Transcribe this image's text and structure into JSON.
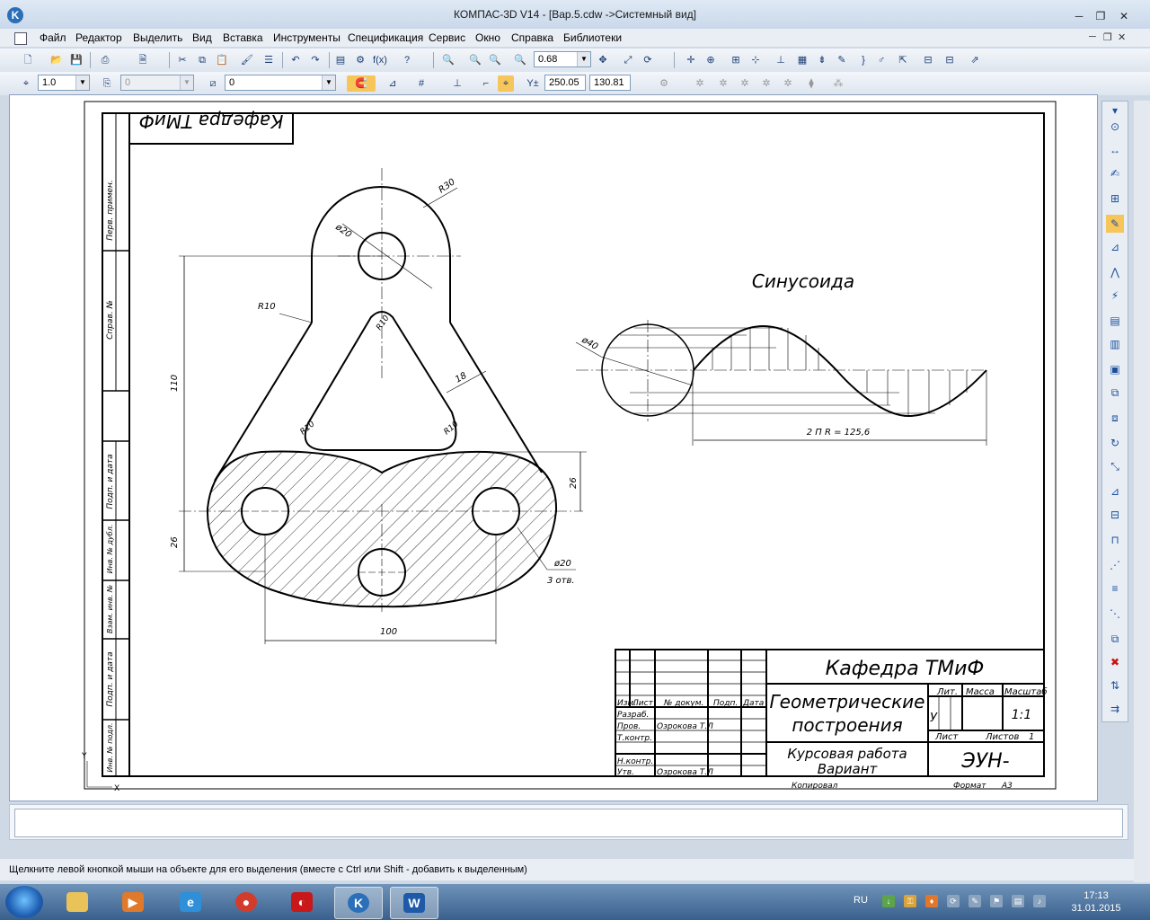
{
  "window": {
    "title": "КОМПАС-3D V14 - [Вар.5.cdw ->Системный вид]",
    "minimize": "─",
    "restore": "❐",
    "close": "✕"
  },
  "menu": {
    "items": [
      "Файл",
      "Редактор",
      "Выделить",
      "Вид",
      "Вставка",
      "Инструменты",
      "Спецификация",
      "Сервис",
      "Окно",
      "Справка",
      "Библиотеки"
    ],
    "doc_minimize": "─",
    "doc_restore": "❐",
    "doc_close": "✕"
  },
  "toolbar1": {
    "zoom_value": "0.68"
  },
  "toolbar2": {
    "line_scale": "1.0",
    "layer_field": "0",
    "style_field": "0",
    "coord_x": "250.05",
    "coord_y": "130.81",
    "coord_label": "Y±"
  },
  "drawing": {
    "department_top_mirrored": "Кафедра ТМиФ",
    "sinusoid_title": "Синусоида",
    "dims": {
      "r30": "R30",
      "d20_top": "ø20",
      "r10_left": "R10",
      "r10_inner_top": "R10",
      "r10_inner_left": "R10",
      "r10_inner_right": "R10",
      "d18": "18",
      "d110": "110",
      "d26_left": "26",
      "d26_right": "26",
      "d20_holes": "ø20",
      "holes_count": "3 отв.",
      "d100": "100",
      "d40": "ø40",
      "sin_length": "2 П R = 125,6"
    },
    "side_stamp": [
      "Перв. примен.",
      "Справ. №",
      "Подп. и дата",
      "Инв. № дубл.",
      "Взам. инв. №",
      "Подп. и дата",
      "Инв. № подл."
    ],
    "title_block": {
      "department": "Кафедра ТМиФ",
      "doc_name_line1": "Геометрические",
      "doc_name_line2": "построения",
      "work_line1": "Курсовая работа",
      "work_line2": "Вариант",
      "designation": "ЭУН-",
      "col_izm": "Изм.",
      "col_list": "Лист",
      "col_ndoc": "№ докум.",
      "col_podp": "Подп.",
      "col_data": "Дата",
      "row_razrab": "Разраб.",
      "row_prov": "Пров.",
      "row_tkontr": "Т.контр.",
      "row_nkontr": "Н.контр.",
      "row_utv": "Утв.",
      "checker": "Озрокова Т.Л",
      "approver": "Озрокова Т.Л",
      "lit": "Лит.",
      "mass": "Масса",
      "scale": "Масштаб",
      "scale_value": "1:1",
      "lit_value": "У",
      "sheet": "Лист",
      "sheets": "Листов",
      "sheets_value": "1",
      "copied": "Копировал",
      "format": "Формат",
      "format_value": "А3"
    },
    "axis_x": "X",
    "axis_y": "Y"
  },
  "status": {
    "hint": "Щелкните левой кнопкой мыши на объекте для его выделения (вместе с Ctrl или Shift - добавить к выделенным)"
  },
  "taskbar": {
    "apps": [
      "explorer",
      "media-player",
      "internet-explorer",
      "chrome",
      "app-red",
      "kompas",
      "word"
    ],
    "language": "RU",
    "time": "17:13",
    "date": "31.01.2015"
  }
}
